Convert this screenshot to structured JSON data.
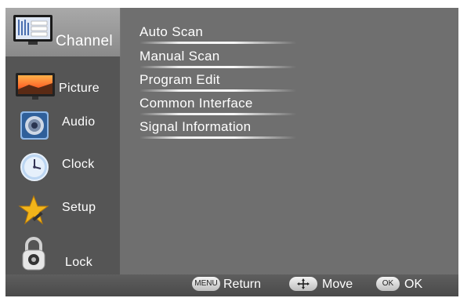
{
  "sidebar": {
    "items": [
      {
        "label": "Channel",
        "icon": "channel-tv-icon",
        "selected": true
      },
      {
        "label": "Picture",
        "icon": "picture-monitor-icon",
        "selected": false
      },
      {
        "label": "Audio",
        "icon": "speaker-icon",
        "selected": false
      },
      {
        "label": "Clock",
        "icon": "clock-icon",
        "selected": false
      },
      {
        "label": "Setup",
        "icon": "star-icon",
        "selected": false
      },
      {
        "label": "Lock",
        "icon": "padlock-icon",
        "selected": false
      }
    ]
  },
  "menu": {
    "items": [
      {
        "label": "Auto Scan"
      },
      {
        "label": "Manual Scan"
      },
      {
        "label": "Program Edit"
      },
      {
        "label": "Common Interface"
      },
      {
        "label": "Signal Information"
      }
    ]
  },
  "footer": {
    "menu_key": "MENU",
    "return_label": "Return",
    "move_label": "Move",
    "ok_key": "OK",
    "ok_label": "OK"
  },
  "colors": {
    "background": "#6f6f6f",
    "sidebar": "#555555",
    "selected": "#a0a0a0",
    "text": "#ffffff"
  }
}
